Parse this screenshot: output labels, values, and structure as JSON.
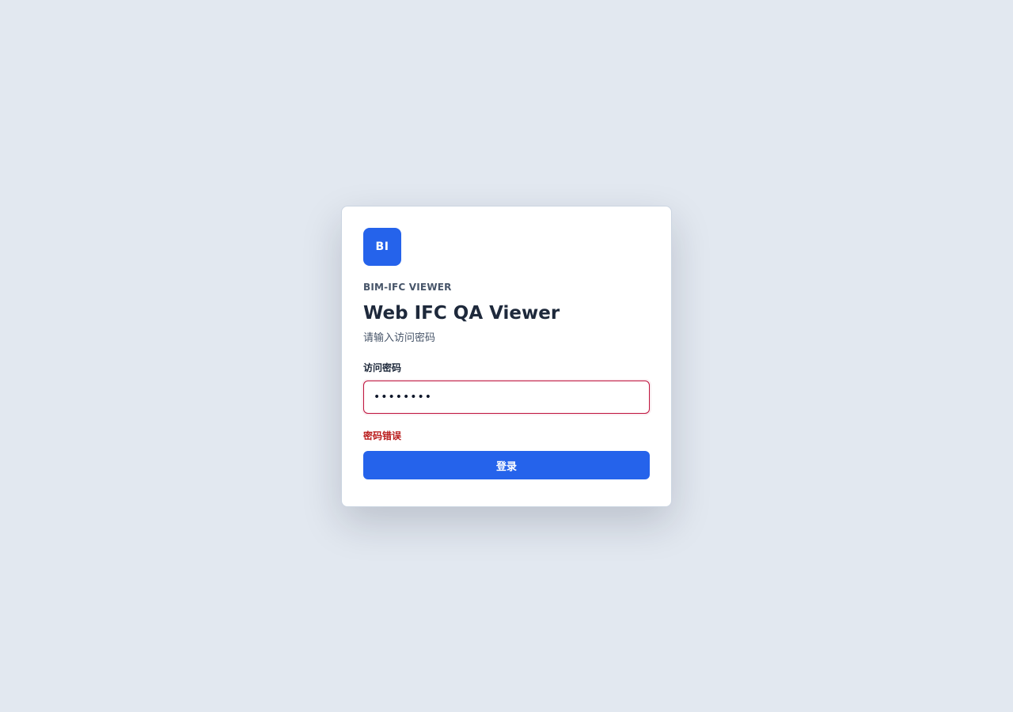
{
  "brand": {
    "logo_text": "BI",
    "eyebrow": "BIM-IFC VIEWER",
    "title": "Web IFC QA Viewer",
    "subtitle": "请输入访问密码"
  },
  "form": {
    "password_label": "访问密码",
    "password_value": "12345678",
    "error_message": "密码错误",
    "submit_label": "登录"
  },
  "colors": {
    "background": "#e2e8f0",
    "accent": "#2563eb",
    "error": "#b91c1c",
    "input_error_border": "#be123c"
  }
}
